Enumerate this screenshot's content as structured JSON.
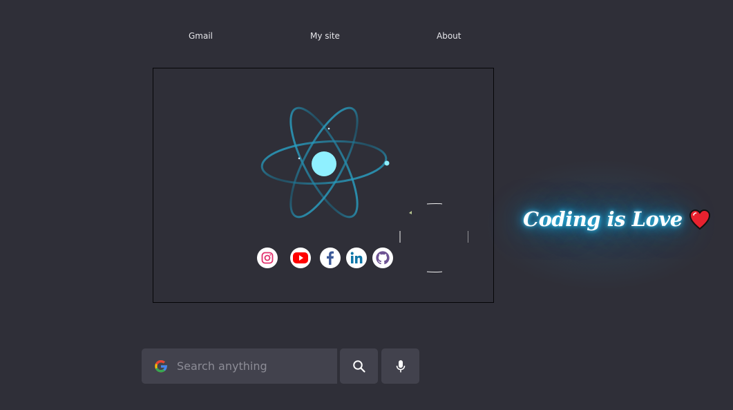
{
  "nav": {
    "gmail": "Gmail",
    "my_site": "My site",
    "about": "About"
  },
  "social": [
    {
      "name": "instagram-icon",
      "color": "#e1306c"
    },
    {
      "name": "youtube-icon",
      "color": "#ff0000"
    },
    {
      "name": "facebook-icon",
      "color": "#3b5998"
    },
    {
      "name": "linkedin-icon",
      "color": "#0e76a8"
    },
    {
      "name": "github-icon",
      "color": "#6e5494"
    }
  ],
  "neon": {
    "text": "Coding is Love",
    "glow_color": "#1aa8e0"
  },
  "search": {
    "placeholder": "Search anything"
  },
  "colors": {
    "background": "#2f2f38",
    "atom_nucleus": "#8ff0ff",
    "atom_orbit": "#1e8fb5"
  }
}
